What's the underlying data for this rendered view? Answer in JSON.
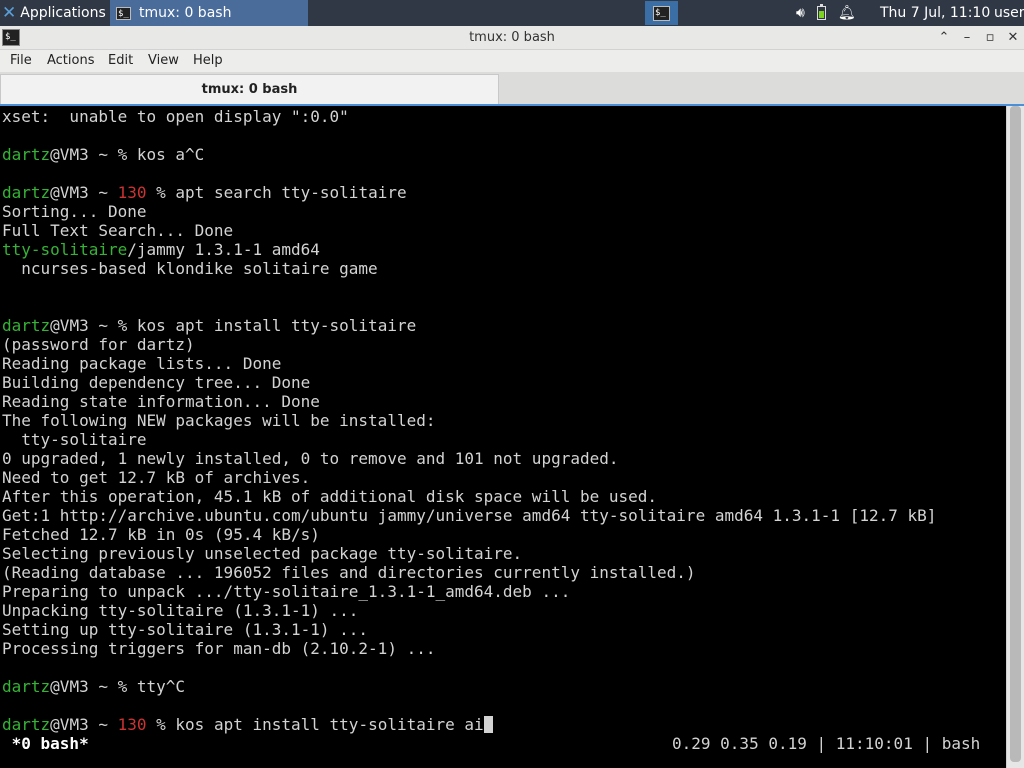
{
  "panel": {
    "applications_label": "Applications",
    "task_label": "tmux: 0 bash",
    "clock": "Thu  7 Jul, 11:10",
    "user": "user",
    "colors": {
      "panel_bg": "#303845",
      "task_bg": "#4a6c9b"
    }
  },
  "window": {
    "title": "tmux: 0 bash",
    "menu": [
      "File",
      "Actions",
      "Edit",
      "View",
      "Help"
    ],
    "tab_label": "tmux: 0 bash"
  },
  "terminal": {
    "lines": [
      [
        {
          "t": "xset:  unable to open display \":0.0\""
        }
      ],
      [],
      [
        {
          "t": "dartz",
          "c": "g"
        },
        {
          "t": "@VM3 ~ % kos a^C"
        }
      ],
      [],
      [
        {
          "t": "dartz",
          "c": "g"
        },
        {
          "t": "@VM3 ~ "
        },
        {
          "t": "130",
          "c": "r"
        },
        {
          "t": " % apt search tty-solitaire"
        }
      ],
      [
        {
          "t": "Sorting... Done"
        }
      ],
      [
        {
          "t": "Full Text Search... Done"
        }
      ],
      [
        {
          "t": "tty-solitaire",
          "c": "g"
        },
        {
          "t": "/jammy 1.3.1-1 amd64"
        }
      ],
      [
        {
          "t": "  ncurses-based klondike solitaire game"
        }
      ],
      [],
      [],
      [
        {
          "t": "dartz",
          "c": "g"
        },
        {
          "t": "@VM3 ~ % kos apt install tty-solitaire"
        }
      ],
      [
        {
          "t": "(password for dartz)"
        }
      ],
      [
        {
          "t": "Reading package lists... Done"
        }
      ],
      [
        {
          "t": "Building dependency tree... Done"
        }
      ],
      [
        {
          "t": "Reading state information... Done"
        }
      ],
      [
        {
          "t": "The following NEW packages will be installed:"
        }
      ],
      [
        {
          "t": "  tty-solitaire"
        }
      ],
      [
        {
          "t": "0 upgraded, 1 newly installed, 0 to remove and 101 not upgraded."
        }
      ],
      [
        {
          "t": "Need to get 12.7 kB of archives."
        }
      ],
      [
        {
          "t": "After this operation, 45.1 kB of additional disk space will be used."
        }
      ],
      [
        {
          "t": "Get:1 http://archive.ubuntu.com/ubuntu jammy/universe amd64 tty-solitaire amd64 1.3.1-1 [12.7 kB]"
        }
      ],
      [
        {
          "t": "Fetched 12.7 kB in 0s (95.4 kB/s)"
        }
      ],
      [
        {
          "t": "Selecting previously unselected package tty-solitaire."
        }
      ],
      [
        {
          "t": "(Reading database ... 196052 files and directories currently installed.)"
        }
      ],
      [
        {
          "t": "Preparing to unpack .../tty-solitaire_1.3.1-1_amd64.deb ..."
        }
      ],
      [
        {
          "t": "Unpacking tty-solitaire (1.3.1-1) ..."
        }
      ],
      [
        {
          "t": "Setting up tty-solitaire (1.3.1-1) ..."
        }
      ],
      [
        {
          "t": "Processing triggers for man-db (2.10.2-1) ..."
        }
      ],
      [],
      [
        {
          "t": "dartz",
          "c": "g"
        },
        {
          "t": "@VM3 ~ % tty^C"
        }
      ],
      [],
      [
        {
          "t": "dartz",
          "c": "g"
        },
        {
          "t": "@VM3 ~ "
        },
        {
          "t": "130",
          "c": "r"
        },
        {
          "t": " % kos apt install tty-solitaire ai"
        },
        {
          "cursor": true
        }
      ]
    ],
    "colors": {
      "green": "#36b336",
      "red": "#cc3434",
      "fg": "#d3d3d3",
      "bg": "#000000"
    }
  },
  "tmux_status": {
    "left": " *0 bash*",
    "right": "0.29 0.35 0.19 | 11:10:01 | bash"
  }
}
